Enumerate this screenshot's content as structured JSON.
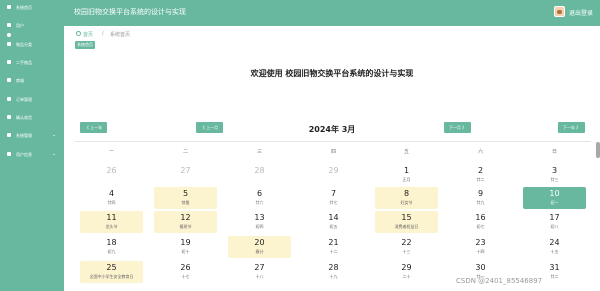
{
  "header": {
    "title": "校园旧物交换平台系统的设计与实现",
    "user_label": "退出登录"
  },
  "sidebar": {
    "items": [
      {
        "label": "系统首页",
        "icon": "home-icon",
        "chevron": ""
      },
      {
        "label": "用户",
        "icon": "user-icon",
        "chevron": ""
      },
      {
        "label": "物品分类",
        "icon": "category-icon",
        "chevron": ""
      },
      {
        "label": "二手物品",
        "icon": "goods-icon",
        "chevron": ""
      },
      {
        "label": "商城",
        "icon": "shop-icon",
        "chevron": ""
      },
      {
        "label": "订单管理",
        "icon": "order-icon",
        "chevron": ""
      },
      {
        "label": "确认收货",
        "icon": "receive-icon",
        "chevron": ""
      },
      {
        "label": "系统管理",
        "icon": "settings-icon",
        "chevron": "⌄"
      },
      {
        "label": "用户信息",
        "icon": "info-icon",
        "chevron": "⌄"
      }
    ]
  },
  "breadcrumb": {
    "home": "首页",
    "separator": "/",
    "current": "系统首页"
  },
  "tag": {
    "label": "系统首页"
  },
  "welcome": "欢迎使用 校园旧物交换平台系统的设计与实现",
  "calendar": {
    "month_title": "2024年 3月",
    "nav": {
      "prev_year": "《 上一年",
      "prev_month": "《 上一月",
      "next_month": "下一月 》",
      "next_year": "下一年 》"
    },
    "weekdays": [
      "一",
      "二",
      "三",
      "四",
      "五",
      "六",
      "日"
    ],
    "weeks": [
      [
        {
          "day": "26",
          "lunar": "",
          "type": "other"
        },
        {
          "day": "27",
          "lunar": "",
          "type": "other"
        },
        {
          "day": "28",
          "lunar": "",
          "type": "other"
        },
        {
          "day": "29",
          "lunar": "",
          "type": "other"
        },
        {
          "day": "1",
          "lunar": "正月",
          "type": "normal"
        },
        {
          "day": "2",
          "lunar": "廿二",
          "type": "normal"
        },
        {
          "day": "3",
          "lunar": "廿三",
          "type": "normal"
        }
      ],
      [
        {
          "day": "4",
          "lunar": "廿四",
          "type": "normal"
        },
        {
          "day": "5",
          "lunar": "惊蛰",
          "type": "yellow"
        },
        {
          "day": "6",
          "lunar": "廿六",
          "type": "normal"
        },
        {
          "day": "7",
          "lunar": "廿七",
          "type": "normal"
        },
        {
          "day": "8",
          "lunar": "妇女节",
          "type": "yellow"
        },
        {
          "day": "9",
          "lunar": "廿九",
          "type": "normal"
        },
        {
          "day": "10",
          "lunar": "初一",
          "type": "today"
        }
      ],
      [
        {
          "day": "11",
          "lunar": "龙头节",
          "type": "yellow"
        },
        {
          "day": "12",
          "lunar": "植树节",
          "type": "yellow"
        },
        {
          "day": "13",
          "lunar": "初四",
          "type": "normal"
        },
        {
          "day": "14",
          "lunar": "初五",
          "type": "normal"
        },
        {
          "day": "15",
          "lunar": "消费者权益日",
          "type": "yellow"
        },
        {
          "day": "16",
          "lunar": "初七",
          "type": "normal"
        },
        {
          "day": "17",
          "lunar": "初八",
          "type": "normal"
        }
      ],
      [
        {
          "day": "18",
          "lunar": "初九",
          "type": "normal"
        },
        {
          "day": "19",
          "lunar": "初十",
          "type": "normal"
        },
        {
          "day": "20",
          "lunar": "春分",
          "type": "yellow"
        },
        {
          "day": "21",
          "lunar": "十二",
          "type": "normal"
        },
        {
          "day": "22",
          "lunar": "十三",
          "type": "normal"
        },
        {
          "day": "23",
          "lunar": "十四",
          "type": "normal"
        },
        {
          "day": "24",
          "lunar": "十五",
          "type": "normal"
        }
      ],
      [
        {
          "day": "25",
          "lunar": "全国中小学生安全教育日",
          "type": "yellow"
        },
        {
          "day": "26",
          "lunar": "十七",
          "type": "normal"
        },
        {
          "day": "27",
          "lunar": "十八",
          "type": "normal"
        },
        {
          "day": "28",
          "lunar": "十九",
          "type": "normal"
        },
        {
          "day": "29",
          "lunar": "二十",
          "type": "normal"
        },
        {
          "day": "30",
          "lunar": "廿一",
          "type": "normal"
        },
        {
          "day": "31",
          "lunar": "廿二",
          "type": "normal"
        }
      ]
    ]
  },
  "watermark": "CSDN @2401_85546897",
  "colors": {
    "accent": "#67b89f",
    "highlight": "#fcf3cf",
    "background": "#ffffff"
  }
}
